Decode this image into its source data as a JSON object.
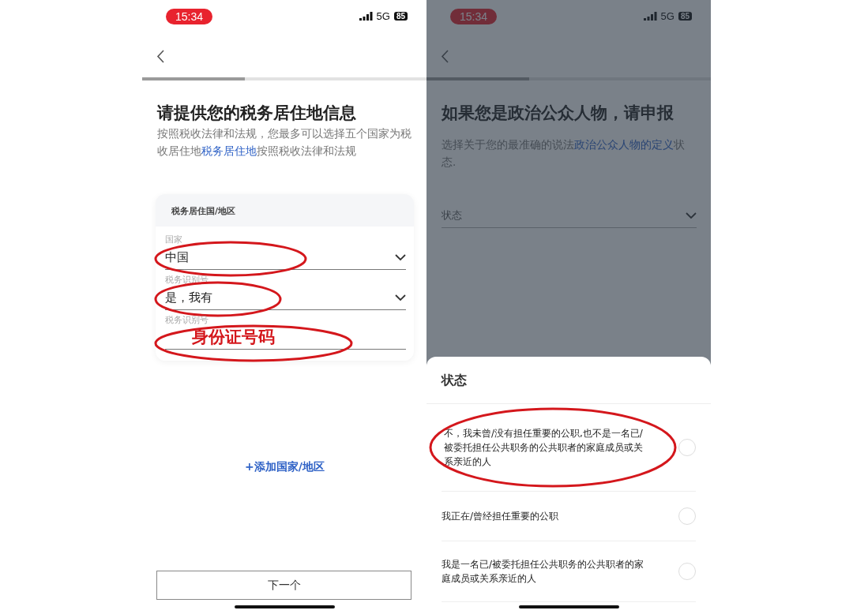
{
  "left_screen": {
    "status_bar": {
      "time": "15:34",
      "network": "5G",
      "battery": "85"
    },
    "progress": {
      "level": 0.36
    },
    "title": "请提供您的税务居住地信息",
    "subtitle": {
      "before": "按照税收法律和法规，您最多可以选择五个国家为税收居住地",
      "link": "税务居住地",
      "after": "按照税收法律和法规"
    },
    "card": {
      "header": "税务居住国/地区",
      "fields": [
        {
          "kind": "select",
          "label": "国家",
          "value": "中国",
          "circled": true
        },
        {
          "kind": "select",
          "label": "税务识别号",
          "value": "是，我有",
          "circled": true
        },
        {
          "kind": "input",
          "label": "税务识别号",
          "annotation": "身份证号码",
          "circled": true
        }
      ]
    },
    "add_link": "+添加国家/地区",
    "next_button": "下一个"
  },
  "right_screen": {
    "status_bar": {
      "time": "15:34",
      "network": "5G",
      "battery": "85"
    },
    "progress": {
      "level": 0.36
    },
    "title": "如果您是政治公众人物，请申报",
    "subtitle": {
      "before": "选择关于您的最准确的说法",
      "link": "政治公众人物的定义",
      "after": "状态."
    },
    "field": {
      "placeholder": "状态"
    },
    "sheet": {
      "title": "状态",
      "options": [
        {
          "label": "不，我未曾/没有担任重要的公职,也不是一名已/被委托担任公共职务的公共职者的家庭成员或关系亲近的人",
          "selected": false,
          "circled": true
        },
        {
          "label": "我正在/曾经担任重要的公职",
          "selected": false,
          "circled": false
        },
        {
          "label": "我是一名已/被委托担任公共职务的公共职者的家庭成员或关系亲近的人",
          "selected": false,
          "circled": false
        }
      ]
    }
  }
}
